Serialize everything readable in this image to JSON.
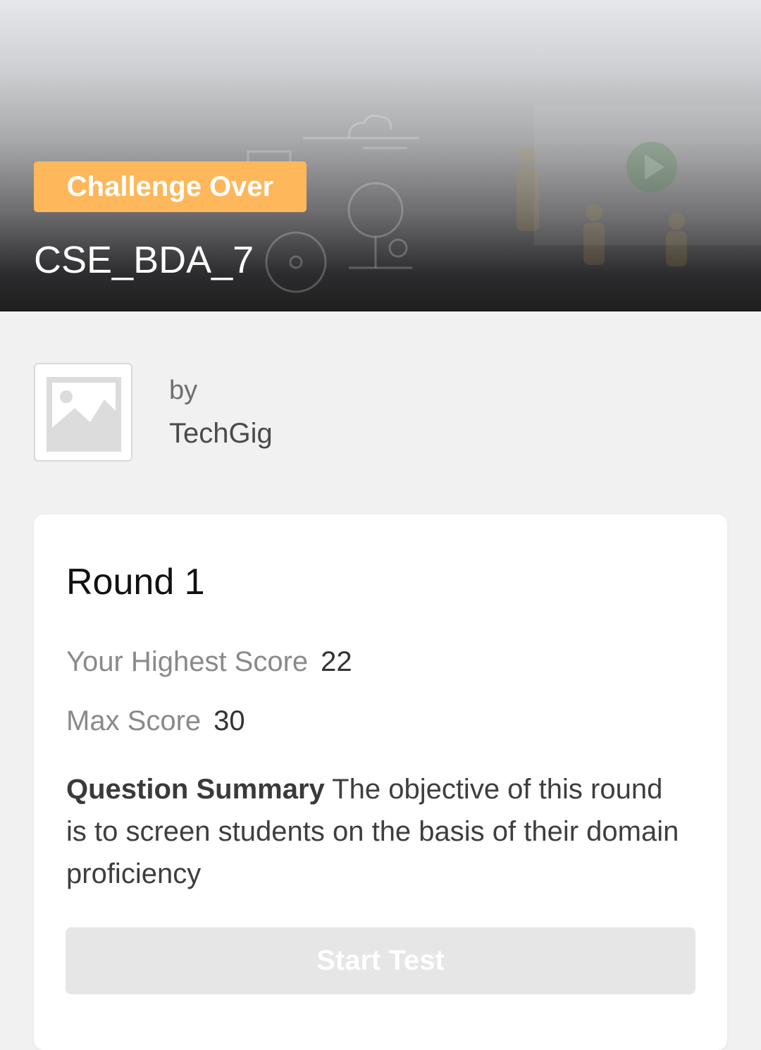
{
  "banner": {
    "status_badge": "Challenge Over",
    "title": "CSE_BDA_7",
    "badge_color": "#feb75a"
  },
  "organizer": {
    "by_label": "by",
    "name": "TechGig",
    "logo_icon": "image-placeholder-icon"
  },
  "round": {
    "title": "Round 1",
    "highest_score_label": "Your Highest Score",
    "highest_score_value": "22",
    "max_score_label": "Max Score",
    "max_score_value": "30",
    "summary_label": "Question Summary",
    "summary_text": "The objective of this round is to screen students on the basis of their domain proficiency",
    "start_button_label": "Start Test"
  }
}
